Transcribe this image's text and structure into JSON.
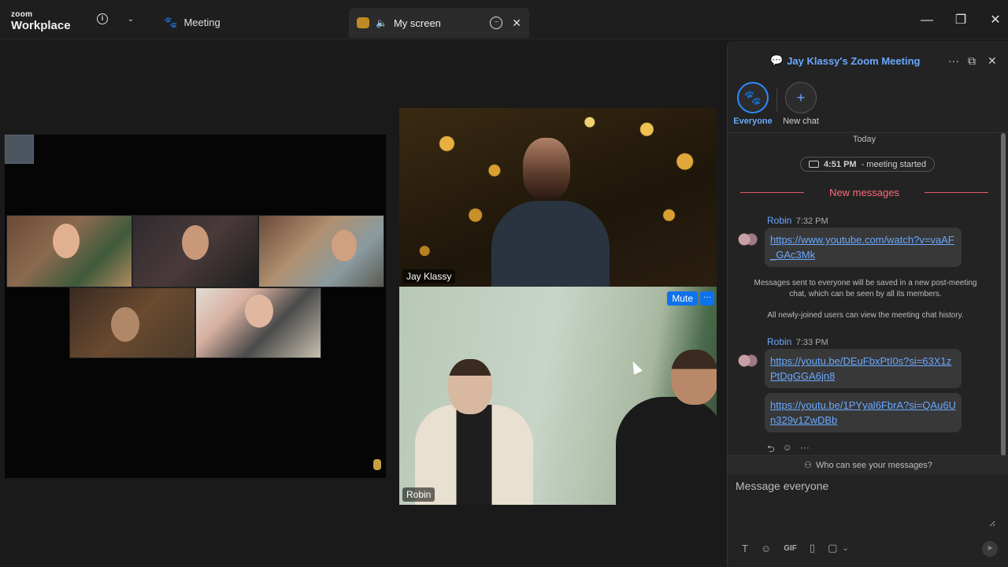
{
  "titlebar": {
    "logo_top": "zoom",
    "logo_bottom": "Workplace",
    "meeting_tab": "Meeting",
    "screen_tab": "My screen",
    "info_glyph": "i",
    "chevron_glyph": "⌄",
    "paw_glyph": "🐾",
    "speaker_glyph": "🔈",
    "dots_glyph": "···",
    "close_glyph": "✕",
    "minimize_glyph": "—",
    "restore_glyph": "❐",
    "window_close_glyph": "✕"
  },
  "videos": {
    "jay_name": "Jay Klassy",
    "robin_name": "Robin",
    "mute_label": "Mute",
    "more_glyph": "···"
  },
  "chat": {
    "title": "Jay Klassy's Zoom Meeting",
    "title_icon": "💬",
    "more_glyph": "···",
    "popout_glyph": "⧉",
    "close_glyph": "✕",
    "tabs": [
      {
        "label": "Everyone",
        "glyph": "🐾",
        "active": true
      },
      {
        "label": "New chat",
        "glyph": "+",
        "active": false
      }
    ],
    "day_label": "Today",
    "meeting_started_time": "4:51 PM",
    "meeting_started_text": "- meeting started",
    "new_messages_label": "New messages",
    "messages": [
      {
        "sender": "Robin",
        "time": "7:32 PM",
        "link": "https://www.youtube.com/watch?v=vaAF_GAc3Mk"
      },
      {
        "sender": "Robin",
        "time": "7:33 PM",
        "link": "https://youtu.be/DEuFbxPtI0s?si=63X1zPtDgGGA6jn8"
      },
      {
        "sender": "",
        "time": "",
        "link": "https://youtu.be/1PYyal6FbrA?si=QAu6Un329v1ZwDBb"
      }
    ],
    "system_note_1": "Messages sent to everyone will be saved in a new post-meeting chat, which can be seen by all its members.",
    "system_note_2": "All newly-joined users can view the meeting chat history.",
    "reaction_glyphs": [
      "⮌",
      "☺",
      "···"
    ],
    "who_can_see": "Who can see your messages?",
    "input_placeholder": "Message everyone",
    "tool_glyphs": [
      "T",
      "☺",
      "GIF",
      "▯",
      "▢",
      "⌄"
    ],
    "send_glyph": "➤"
  },
  "colors": {
    "accent": "#2d8cff",
    "link": "#6aa8ff",
    "new_messages": "#ff6b7a",
    "mute_button": "#0e72ed"
  }
}
